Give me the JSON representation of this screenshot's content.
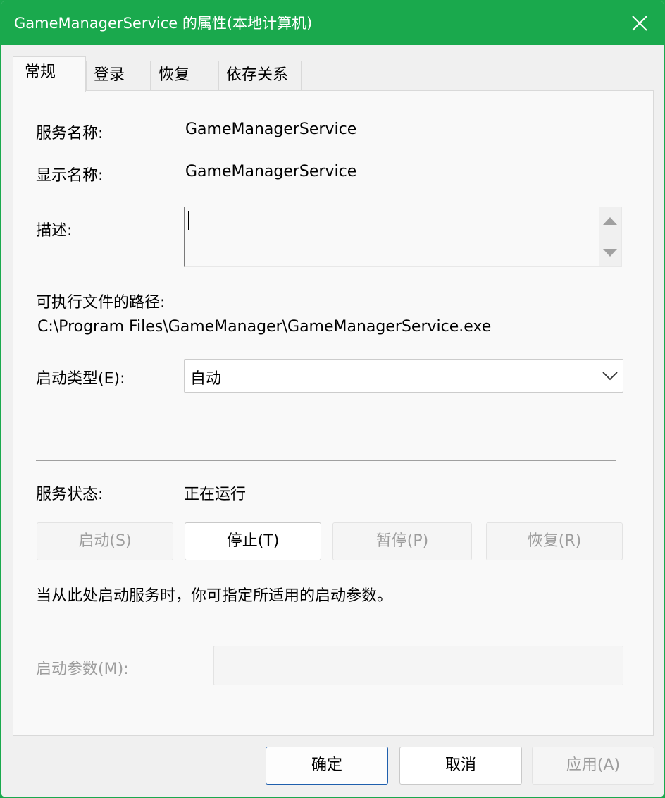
{
  "window": {
    "title": "GameManagerService 的属性(本地计算机)"
  },
  "tabs": [
    {
      "label": "常规"
    },
    {
      "label": "登录"
    },
    {
      "label": "恢复"
    },
    {
      "label": "依存关系"
    }
  ],
  "general": {
    "service_name_label": "服务名称:",
    "service_name_value": "GameManagerService",
    "display_name_label": "显示名称:",
    "display_name_value": "GameManagerService",
    "description_label": "描述:",
    "description_value": "",
    "exec_path_label": "可执行文件的路径:",
    "exec_path_value": "C:\\Program Files\\GameManager\\GameManagerService.exe",
    "startup_type_label": "启动类型(E):",
    "startup_type_value": "自动",
    "service_status_label": "服务状态:",
    "service_status_value": "正在运行",
    "start_button": "启动(S)",
    "stop_button": "停止(T)",
    "pause_button": "暂停(P)",
    "resume_button": "恢复(R)",
    "start_hint": "当从此处启动服务时，你可指定所适用的启动参数。",
    "start_params_label": "启动参数(M):",
    "start_params_value": ""
  },
  "footer": {
    "ok_button": "确定",
    "cancel_button": "取消",
    "apply_button": "应用(A)"
  },
  "colors": {
    "titlebar": "#1aa94d",
    "primary_border": "#1f5fad",
    "disabled_text": "#9d9d9d"
  },
  "icons": {
    "close": "close-icon",
    "dropdown": "chevron-down-icon",
    "scroll_up": "scroll-up-arrow-icon",
    "scroll_down": "scroll-down-arrow-icon"
  }
}
